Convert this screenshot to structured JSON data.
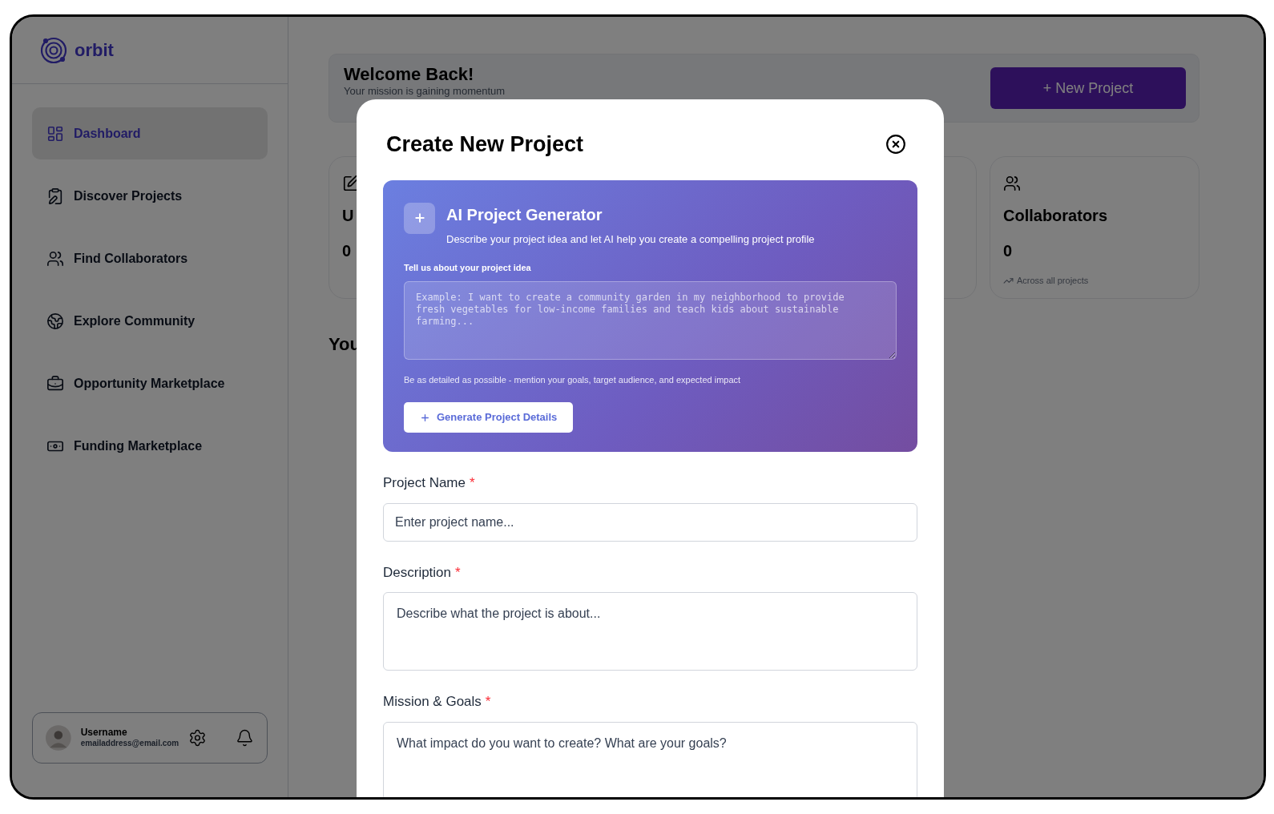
{
  "sidebar": {
    "logo": "orbit",
    "items": [
      {
        "label": "Dashboard",
        "selected": true
      },
      {
        "label": "Discover Projects",
        "selected": false
      },
      {
        "label": "Find Collaborators",
        "selected": false
      },
      {
        "label": "Explore Community",
        "selected": false
      },
      {
        "label": "Opportunity Marketplace",
        "selected": false
      },
      {
        "label": "Funding Marketplace",
        "selected": false
      }
    ],
    "user": {
      "name": "Username",
      "email": "emailaddress@email.com"
    }
  },
  "header": {
    "title": "Welcome Back!",
    "subtitle": "Your mission is gaining momentum",
    "button": "+ New Project"
  },
  "stats": [
    {
      "kind": "stat",
      "title": "U",
      "value": "0"
    },
    {
      "kind": "blank"
    },
    {
      "kind": "stat",
      "title": "Collaborators",
      "value": "0",
      "note": "Across all projects"
    }
  ],
  "section_title": "You",
  "modal": {
    "title": "Create New Project",
    "generator": {
      "title": "AI Project Generator",
      "subtitle": "Describe your project idea and let AI help you create a compelling project profile",
      "label": "Tell us about your project idea",
      "placeholder": "Example: I want to create a community garden in my neighborhood to provide fresh vegetables for low-income families and teach kids about sustainable farming...",
      "hint": "Be as detailed as possible - mention your goals, target audience, and expected impact",
      "button": "Generate Project Details"
    },
    "fields": [
      {
        "label": "Project Name",
        "required_mark": "*",
        "kind": "input",
        "placeholder": "Enter project name..."
      },
      {
        "label": "Description",
        "required_mark": "*",
        "kind": "textarea",
        "placeholder": "Describe what the project is about..."
      },
      {
        "label": "Mission & Goals",
        "required_mark": "*",
        "kind": "textarea",
        "placeholder": "What impact do you want to create? What are your goals?"
      }
    ]
  }
}
